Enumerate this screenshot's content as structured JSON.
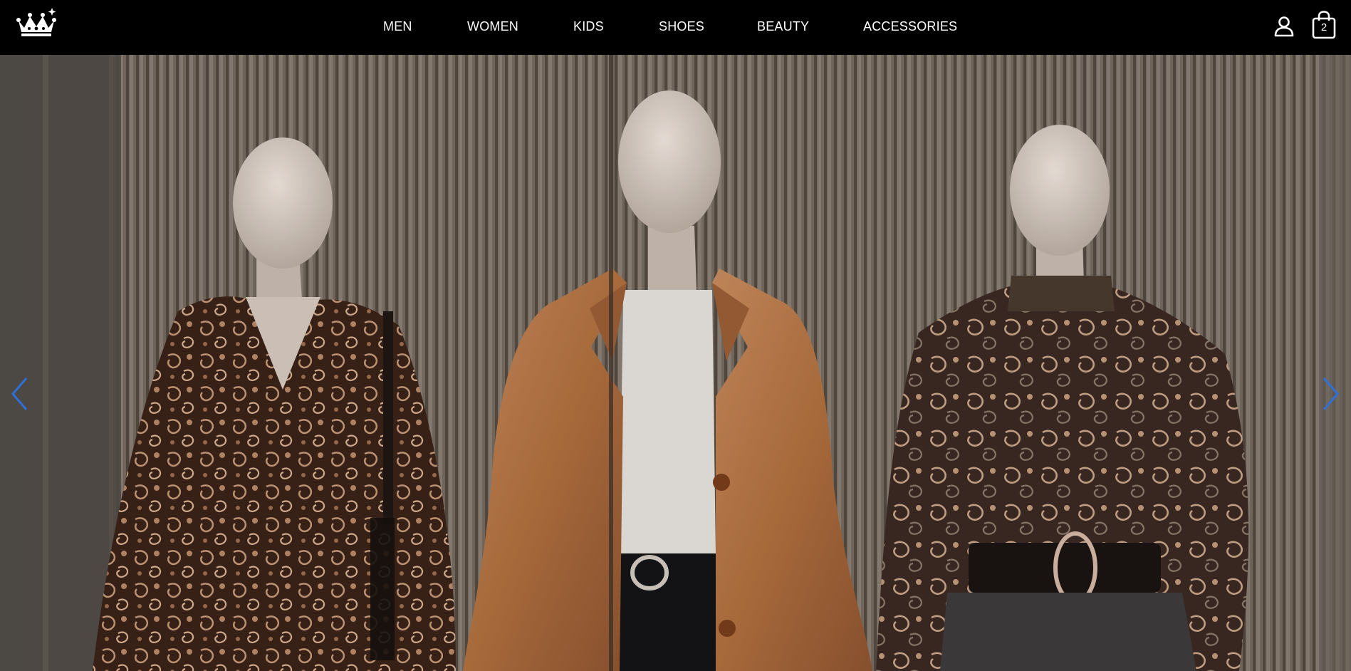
{
  "header": {
    "logo_icon": "crown-icon",
    "nav": [
      {
        "label": "MEN"
      },
      {
        "label": "WOMEN"
      },
      {
        "label": "KIDS"
      },
      {
        "label": "SHOES"
      },
      {
        "label": "BEAUTY"
      },
      {
        "label": "ACCESSORIES"
      }
    ],
    "account_icon": "user-icon",
    "cart_icon": "shopping-bag-icon",
    "cart_count": "2"
  },
  "hero": {
    "image": "three-mannequins-in-paisley-dress-suede-coat-and-blouse",
    "prev_icon": "chevron-left-icon",
    "next_icon": "chevron-right-icon",
    "arrow_color": "#2f6fd6"
  },
  "colors": {
    "nav_background": "#000000",
    "nav_text": "#ffffff"
  }
}
